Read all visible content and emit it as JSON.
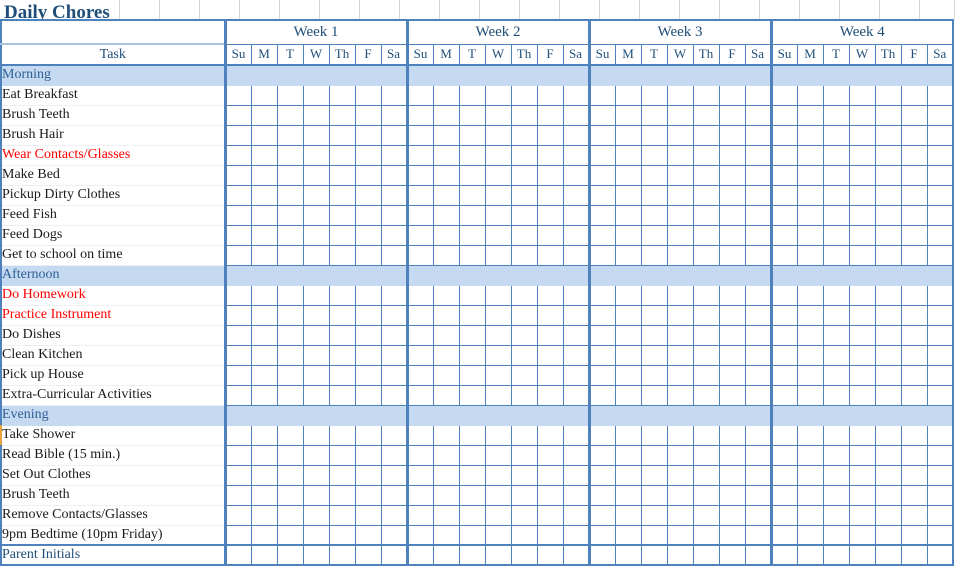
{
  "page_title": "Daily Chores",
  "colors": {
    "grid_blue": "#4f81bd",
    "band_blue": "#c5d9f1",
    "header_text": "#1f4e79",
    "section_text": "#2e6096",
    "highlight_red": "#ff0000",
    "sheet_gridline": "#d4d4d4"
  },
  "table": {
    "task_column_header": "Task",
    "blank_corner_header": "",
    "weeks": [
      {
        "label": "Week 1",
        "days": [
          "Su",
          "M",
          "T",
          "W",
          "Th",
          "F",
          "Sa"
        ]
      },
      {
        "label": "Week 2",
        "days": [
          "Su",
          "M",
          "T",
          "W",
          "Th",
          "F",
          "Sa"
        ]
      },
      {
        "label": "Week 3",
        "days": [
          "Su",
          "M",
          "T",
          "W",
          "Th",
          "F",
          "Sa"
        ]
      },
      {
        "label": "Week 4",
        "days": [
          "Su",
          "M",
          "T",
          "W",
          "Th",
          "F",
          "Sa"
        ]
      }
    ],
    "sections": [
      {
        "label": "Morning",
        "tasks": [
          {
            "label": "Eat Breakfast",
            "color": "black"
          },
          {
            "label": "Brush Teeth",
            "color": "black"
          },
          {
            "label": "Brush Hair",
            "color": "black"
          },
          {
            "label": "Wear Contacts/Glasses",
            "color": "red"
          },
          {
            "label": "Make Bed",
            "color": "black"
          },
          {
            "label": "Pickup Dirty Clothes",
            "color": "black"
          },
          {
            "label": "Feed Fish",
            "color": "black"
          },
          {
            "label": "Feed Dogs",
            "color": "black"
          },
          {
            "label": "Get to school on time",
            "color": "black"
          }
        ]
      },
      {
        "label": "Afternoon",
        "tasks": [
          {
            "label": "Do Homework",
            "color": "red"
          },
          {
            "label": "Practice Instrument",
            "color": "red"
          },
          {
            "label": "Do Dishes",
            "color": "black"
          },
          {
            "label": "Clean Kitchen",
            "color": "black"
          },
          {
            "label": "Pick up House",
            "color": "black"
          },
          {
            "label": "Extra-Curricular Activities",
            "color": "black"
          }
        ]
      },
      {
        "label": "Evening",
        "tasks": [
          {
            "label": "Take Shower",
            "color": "black"
          },
          {
            "label": "Read Bible (15 min.)",
            "color": "black"
          },
          {
            "label": "Set Out Clothes",
            "color": "black"
          },
          {
            "label": "Brush Teeth",
            "color": "black"
          },
          {
            "label": "Remove Contacts/Glasses",
            "color": "black"
          },
          {
            "label": "9pm Bedtime (10pm Friday)",
            "color": "black"
          }
        ]
      }
    ],
    "footer_row_label": "Parent Initials"
  }
}
